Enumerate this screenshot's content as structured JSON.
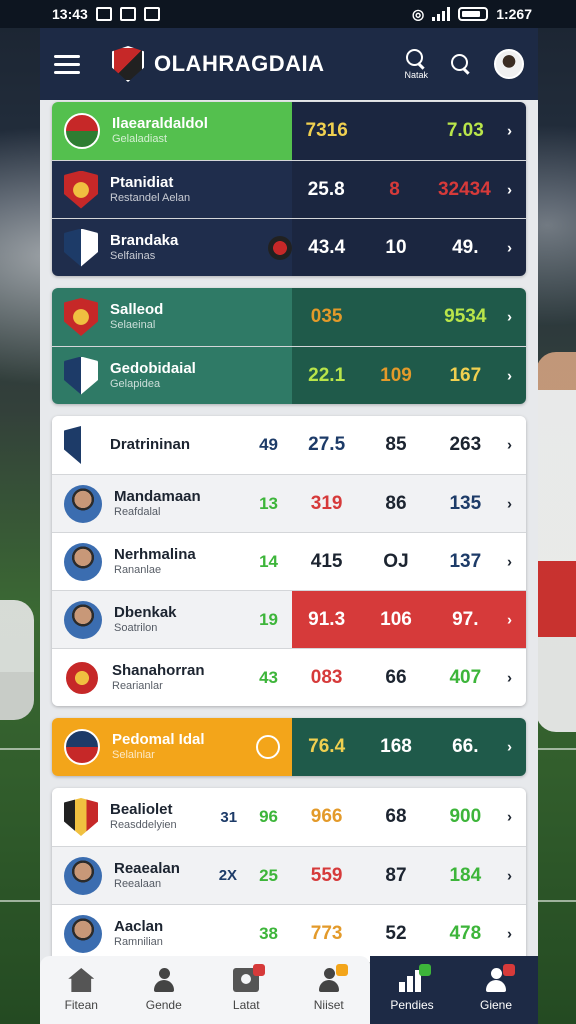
{
  "status_bar": {
    "time_left": "13:43",
    "time_right": "1:267"
  },
  "header": {
    "title": "OLAHRAGDAIA",
    "search_label": "Natak",
    "menu_icon": "hamburger-icon",
    "logo_icon": "club-crest-icon"
  },
  "groups": [
    {
      "theme": "navy",
      "rows": [
        {
          "name": "Ilaearaldaldol",
          "sub": "Gelaladiast",
          "values": [
            "7316",
            "",
            "7.03"
          ],
          "value_colors": [
            "yellow",
            "",
            "lime"
          ],
          "highlight": true
        },
        {
          "name": "Ptanidiat",
          "sub": "Restandel Aelan",
          "values": [
            "25.8",
            "8",
            "32434"
          ],
          "value_colors": [
            "",
            "red",
            "red"
          ]
        },
        {
          "name": "Brandaka",
          "sub": "Selfainas",
          "values": [
            "43.4",
            "10",
            "49."
          ],
          "value_colors": [
            "",
            "",
            ""
          ]
        }
      ]
    },
    {
      "theme": "teal",
      "rows": [
        {
          "name": "Salleod",
          "sub": "Selaeinal",
          "values": [
            "035",
            "",
            "9534"
          ],
          "value_colors": [
            "orange",
            "",
            "lime"
          ]
        },
        {
          "name": "Gedobidaial",
          "sub": "Gelapidea",
          "values": [
            "22.1",
            "109",
            "167"
          ],
          "value_colors": [
            "lime",
            "orange",
            "yellow"
          ]
        }
      ]
    },
    {
      "theme": "white",
      "rows": [
        {
          "name": "Dratrininan",
          "sub": "",
          "rank": "49",
          "rank_color": "navy",
          "values": [
            "27.5",
            "85",
            "263"
          ],
          "value_colors": [
            "navy",
            "",
            ""
          ]
        },
        {
          "name": "Mandamaan",
          "sub": "Reafdalal",
          "rank": "13",
          "rank_color": "green",
          "values": [
            "319",
            "86",
            "135"
          ],
          "value_colors": [
            "red",
            "",
            "navy"
          ],
          "alt": true
        },
        {
          "name": "Nerhmalina",
          "sub": "Rananlae",
          "rank": "14",
          "rank_color": "green",
          "values": [
            "415",
            "OJ",
            "137"
          ],
          "value_colors": [
            "",
            "",
            "navy"
          ]
        },
        {
          "name": "Dbenkak",
          "sub": "Soatrilon",
          "rank": "19",
          "rank_color": "green",
          "values": [
            "91.3",
            "106",
            "97."
          ],
          "value_colors": [
            "",
            "",
            ""
          ],
          "red": true,
          "alt": true
        },
        {
          "name": "Shanahorran",
          "sub": "Rearianlar",
          "rank": "43",
          "rank_color": "green",
          "values": [
            "083",
            "66",
            "407"
          ],
          "value_colors": [
            "red",
            "",
            "green"
          ]
        }
      ]
    },
    {
      "theme": "orange",
      "rows": [
        {
          "name": "Pedomal Idal",
          "sub": "Selalnlar",
          "values": [
            "76.4",
            "168",
            "66."
          ],
          "value_colors": [
            "yellow",
            "",
            ""
          ]
        }
      ]
    },
    {
      "theme": "white",
      "rows": [
        {
          "name": "Bealiolet",
          "sub": "Reasddelyien",
          "extra": "31",
          "rank": "96",
          "rank_color": "green",
          "values": [
            "966",
            "68",
            "900"
          ],
          "value_colors": [
            "orange",
            "",
            "green"
          ]
        },
        {
          "name": "Reaealan",
          "sub": "Reealaan",
          "extra": "2X",
          "rank": "25",
          "rank_color": "green",
          "values": [
            "559",
            "87",
            "184"
          ],
          "value_colors": [
            "red",
            "",
            "green"
          ],
          "alt": true
        },
        {
          "name": "Aaclan",
          "sub": "Ramnilian",
          "rank": "38",
          "rank_color": "green",
          "values": [
            "773",
            "52",
            "478"
          ],
          "value_colors": [
            "orange",
            "",
            "green"
          ]
        }
      ]
    }
  ],
  "bottom_nav": [
    {
      "label": "Fitean",
      "icon": "home-icon"
    },
    {
      "label": "Gende",
      "icon": "person-icon"
    },
    {
      "label": "Latat",
      "icon": "camera-icon"
    },
    {
      "label": "Niiset",
      "icon": "person-icon"
    },
    {
      "label": "Pendies",
      "icon": "chart-icon"
    },
    {
      "label": "Giene",
      "icon": "person-icon"
    }
  ]
}
